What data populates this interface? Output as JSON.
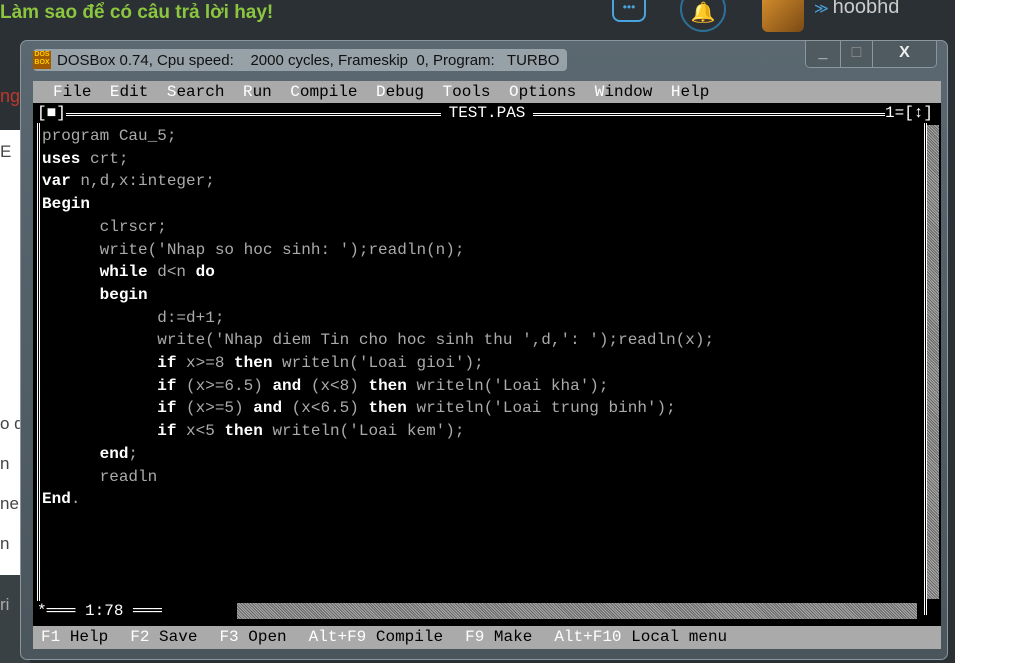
{
  "page": {
    "question_title": "Làm sao để có câu trả lời hay!",
    "username": "hoobhd",
    "side_fragments": [
      "ng",
      "E",
      "o d",
      "n",
      "ne",
      "n",
      "ri"
    ]
  },
  "window": {
    "title": "DOSBox 0.74, Cpu speed:    2000 cycles, Frameskip  0, Program:   TURBO",
    "icon_text": "DOS BOX",
    "minimize": "_",
    "maximize": "□",
    "close": "X"
  },
  "menu": [
    {
      "hot": "F",
      "rest": "ile"
    },
    {
      "hot": "E",
      "rest": "dit"
    },
    {
      "hot": "S",
      "rest": "earch"
    },
    {
      "hot": "R",
      "rest": "un"
    },
    {
      "hot": "C",
      "rest": "ompile"
    },
    {
      "hot": "D",
      "rest": "ebug"
    },
    {
      "hot": "T",
      "rest": "ools"
    },
    {
      "hot": "O",
      "rest": "ptions"
    },
    {
      "hot": "W",
      "rest": "indow"
    },
    {
      "hot": "H",
      "rest": "elp"
    }
  ],
  "editor": {
    "filename": "TEST.PAS",
    "close_box": "[■]",
    "window_number": "1=[↕]",
    "cursor_position": "1:78",
    "code": [
      [
        {
          "t": "program",
          "k": false
        },
        {
          "t": " Cau_5;",
          "k": false
        }
      ],
      [
        {
          "t": "uses",
          "k": true
        },
        {
          "t": " crt;",
          "k": false
        }
      ],
      [
        {
          "t": "var",
          "k": true
        },
        {
          "t": " n,d,x:integer;",
          "k": false
        }
      ],
      [
        {
          "t": "Begin",
          "k": true
        }
      ],
      [
        {
          "t": "      clrscr;",
          "k": false
        }
      ],
      [
        {
          "t": "      write('Nhap so hoc sinh: ');readln(n);",
          "k": false
        }
      ],
      [
        {
          "t": "      ",
          "k": false
        },
        {
          "t": "while",
          "k": true
        },
        {
          "t": " d<n ",
          "k": false
        },
        {
          "t": "do",
          "k": true
        }
      ],
      [
        {
          "t": "      ",
          "k": false
        },
        {
          "t": "begin",
          "k": true
        }
      ],
      [
        {
          "t": "            d:=d+1;",
          "k": false
        }
      ],
      [
        {
          "t": "            write('Nhap diem Tin cho hoc sinh thu ',d,': ');readln(x);",
          "k": false
        }
      ],
      [
        {
          "t": "            ",
          "k": false
        },
        {
          "t": "if",
          "k": true
        },
        {
          "t": " x>=8 ",
          "k": false
        },
        {
          "t": "then",
          "k": true
        },
        {
          "t": " writeln('Loai gioi');",
          "k": false
        }
      ],
      [
        {
          "t": "            ",
          "k": false
        },
        {
          "t": "if",
          "k": true
        },
        {
          "t": " (x>=6.5) ",
          "k": false
        },
        {
          "t": "and",
          "k": true
        },
        {
          "t": " (x<8) ",
          "k": false
        },
        {
          "t": "then",
          "k": true
        },
        {
          "t": " writeln('Loai kha');",
          "k": false
        }
      ],
      [
        {
          "t": "            ",
          "k": false
        },
        {
          "t": "if",
          "k": true
        },
        {
          "t": " (x>=5) ",
          "k": false
        },
        {
          "t": "and",
          "k": true
        },
        {
          "t": " (x<6.5) ",
          "k": false
        },
        {
          "t": "then",
          "k": true
        },
        {
          "t": " writeln('Loai trung binh');",
          "k": false
        }
      ],
      [
        {
          "t": "            ",
          "k": false
        },
        {
          "t": "if",
          "k": true
        },
        {
          "t": " x<5 ",
          "k": false
        },
        {
          "t": "then",
          "k": true
        },
        {
          "t": " writeln('Loai kem');",
          "k": false
        }
      ],
      [
        {
          "t": "      ",
          "k": false
        },
        {
          "t": "end",
          "k": true
        },
        {
          "t": ";",
          "k": false
        }
      ],
      [
        {
          "t": "      readln",
          "k": false
        }
      ],
      [
        {
          "t": "End",
          "k": true
        },
        {
          "t": ".",
          "k": false
        }
      ]
    ]
  },
  "statusbar": [
    {
      "key": "F1",
      "label": "Help"
    },
    {
      "key": "F2",
      "label": "Save"
    },
    {
      "key": "F3",
      "label": "Open"
    },
    {
      "key": "Alt+F9",
      "label": "Compile"
    },
    {
      "key": "F9",
      "label": "Make"
    },
    {
      "key": "Alt+F10",
      "label": "Local menu"
    }
  ]
}
